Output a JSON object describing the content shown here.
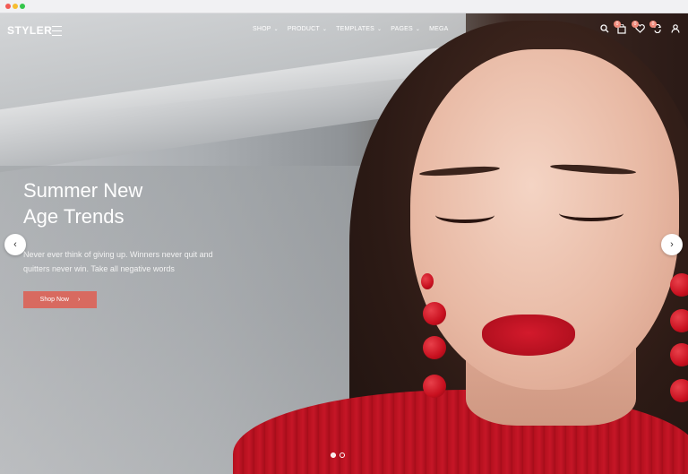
{
  "brand": {
    "name": "STYLER"
  },
  "nav": {
    "items": [
      {
        "label": "SHOP",
        "has_dropdown": true
      },
      {
        "label": "PRODUCT",
        "has_dropdown": true
      },
      {
        "label": "TEMPLATES",
        "has_dropdown": true
      },
      {
        "label": "PAGES",
        "has_dropdown": true
      },
      {
        "label": "MEGA",
        "has_dropdown": false
      }
    ]
  },
  "tools": [
    {
      "icon": "search-icon",
      "badge": ""
    },
    {
      "icon": "cart-icon",
      "badge": "0"
    },
    {
      "icon": "heart-icon",
      "badge": "0"
    },
    {
      "icon": "compare-icon",
      "badge": "0"
    },
    {
      "icon": "user-icon",
      "badge": ""
    }
  ],
  "hero": {
    "title_line1": "Summer New",
    "title_line2": "Age Trends",
    "desc_line1": "Never ever think of giving up. Winners never quit and",
    "desc_line2": "quitters never win. Take all negative words",
    "cta_label": "Shop Now"
  },
  "slider": {
    "slide_count": 2,
    "active_index": 0
  },
  "colors": {
    "accent": "#d86a60",
    "badge": "#f08a7a",
    "lip_red": "#c8101f"
  }
}
